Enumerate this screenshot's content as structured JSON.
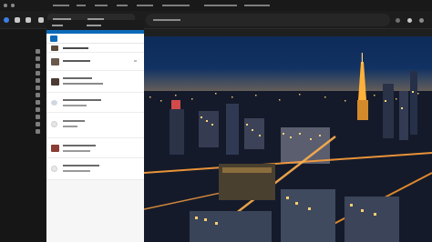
{
  "browser": {
    "window_controls": [
      "close",
      "minimize",
      "maximize"
    ],
    "tabs": [
      {
        "label": ""
      },
      {
        "label": ""
      }
    ],
    "address_bar": {
      "url": ""
    }
  },
  "panel": {
    "header_title": "",
    "toolbar_title": "",
    "items": [
      {
        "title": "",
        "subtitle": ""
      },
      {
        "title": "",
        "subtitle": ""
      },
      {
        "title": "",
        "subtitle": ""
      },
      {
        "title": "",
        "subtitle": ""
      },
      {
        "title": "",
        "subtitle": ""
      },
      {
        "title": "",
        "subtitle": ""
      },
      {
        "title": "",
        "subtitle": ""
      }
    ]
  },
  "image": {
    "subject": "night-city-skyline"
  },
  "colors": {
    "accent": "#0b6ab8",
    "dark_bg": "#1f1f1f",
    "panel_bg": "#f6f6f6"
  }
}
